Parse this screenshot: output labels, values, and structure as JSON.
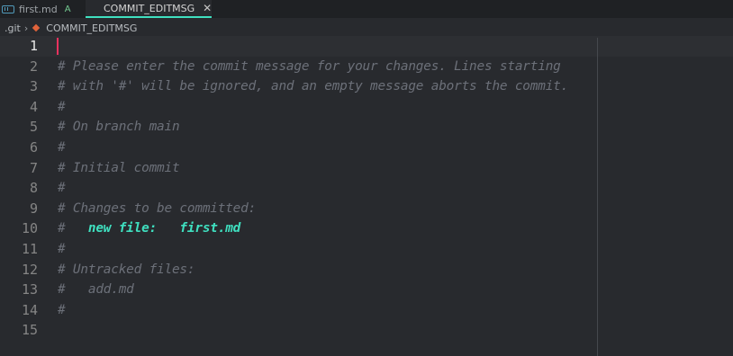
{
  "tabs": [
    {
      "label": "first.md",
      "icon": "markdown-icon",
      "status": "A",
      "active": false
    },
    {
      "label": "COMMIT_EDITMSG",
      "icon": "git-icon",
      "close": "✕",
      "active": true
    }
  ],
  "breadcrumb": {
    "folder": ".git",
    "separator": "›",
    "file": "COMMIT_EDITMSG"
  },
  "editor": {
    "current_line": 1,
    "lines": [
      {
        "n": "1",
        "text": ""
      },
      {
        "n": "2",
        "text": "# Please enter the commit message for your changes. Lines starting"
      },
      {
        "n": "3",
        "text": "# with '#' will be ignored, and an empty message aborts the commit."
      },
      {
        "n": "4",
        "text": "#"
      },
      {
        "n": "5",
        "text": "# On branch main"
      },
      {
        "n": "6",
        "text": "#"
      },
      {
        "n": "7",
        "text": "# Initial commit"
      },
      {
        "n": "8",
        "text": "#"
      },
      {
        "n": "9",
        "text": "# Changes to be committed:"
      },
      {
        "n": "10",
        "prefix": "#   ",
        "highlight": "new file:   first.md"
      },
      {
        "n": "11",
        "text": "#"
      },
      {
        "n": "12",
        "text": "# Untracked files:"
      },
      {
        "n": "13",
        "text": "#   add.md"
      },
      {
        "n": "14",
        "text": "#"
      },
      {
        "n": "15",
        "text": ""
      }
    ]
  },
  "colors": {
    "background": "#282a2e",
    "comment": "#6c7079",
    "highlight": "#3fe0c0",
    "cursor": "#e8325f",
    "git_accent": "#e0633b"
  }
}
